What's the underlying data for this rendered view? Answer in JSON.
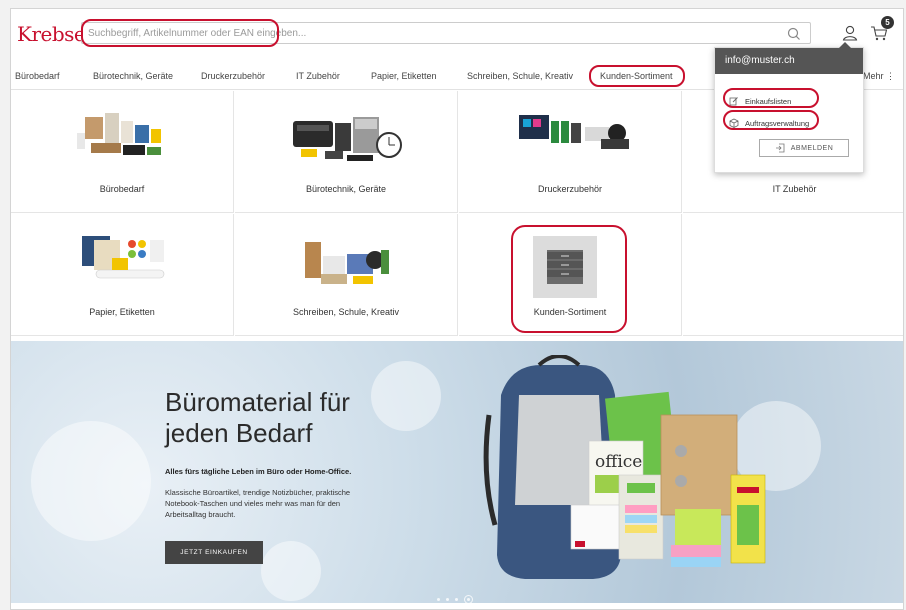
{
  "header": {
    "logo": "Krebser",
    "search_placeholder": "Suchbegriff, Artikelnummer oder EAN eingeben...",
    "cart_count": "5"
  },
  "nav": {
    "items": [
      "Bürobedarf",
      "Bürotechnik, Geräte",
      "Druckerzubehör",
      "IT Zubehör",
      "Papier, Etiketten",
      "Schreiben, Schule, Kreativ",
      "Kunden-Sortiment"
    ],
    "more": "Mehr"
  },
  "account_menu": {
    "email": "info@muster.ch",
    "items": [
      "Einkaufslisten",
      "Auftragsverwaltung"
    ],
    "logout": "ABMELDEN"
  },
  "categories": [
    "Bürobedarf",
    "Bürotechnik, Geräte",
    "Druckerzubehör",
    "IT Zubehör",
    "Papier, Etiketten",
    "Schreiben, Schule, Kreativ",
    "Kunden-Sortiment"
  ],
  "hero": {
    "title_line1": "Büromaterial für",
    "title_line2": "jeden Bedarf",
    "subtitle": "Alles fürs tägliche Leben im Büro oder Home-Office.",
    "description": "Klassische Büroartikel, trendige Notizbücher, praktische Notebook-Taschen und vieles mehr was man für den Arbeitsalltag braucht.",
    "button": "JETZT EINKAUFEN",
    "slide_active": 4,
    "slide_count": 4,
    "product_label": "office"
  },
  "colors": {
    "brand": "#c8102e",
    "highlight": "#c8102e",
    "dark_button": "#444444"
  }
}
